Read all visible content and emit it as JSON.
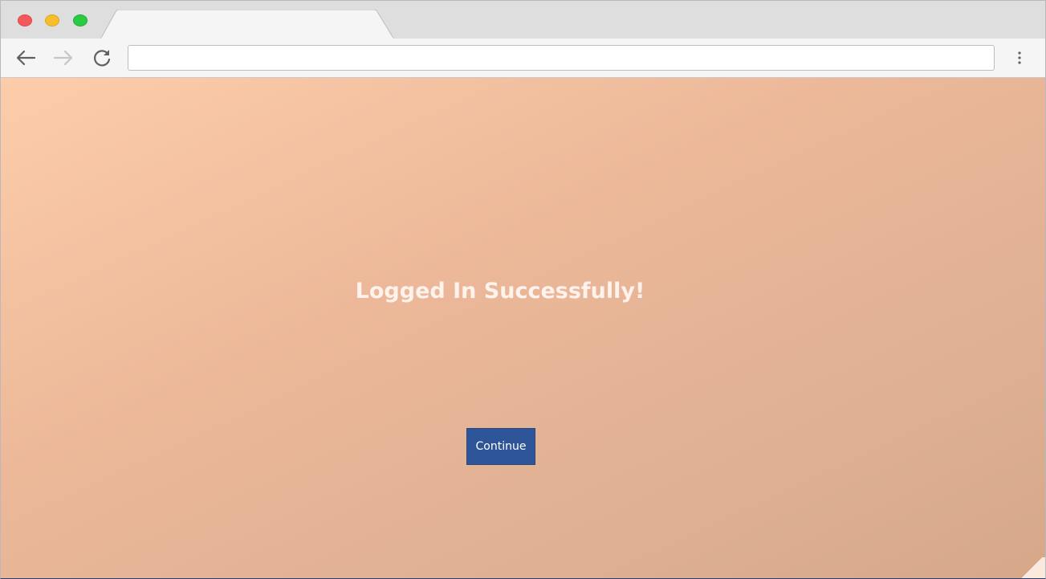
{
  "browser": {
    "tab": {
      "title": ""
    },
    "address_bar": {
      "value": "",
      "placeholder": ""
    },
    "icons": {
      "close": "red-close-dot-icon",
      "minimize": "yellow-minimize-dot-icon",
      "maximize": "green-maximize-dot-icon",
      "back": "back-arrow-icon",
      "forward": "forward-arrow-icon",
      "reload": "reload-icon",
      "menu": "kebab-menu-icon"
    },
    "colors": {
      "close": "#f4585a",
      "minimize": "#f8bd2d",
      "maximize": "#2acb43",
      "chrome_bg": "#dedede",
      "toolbar_bg": "#f5f5f5"
    }
  },
  "page": {
    "headline": "Logged In Successfully!",
    "continue_label": "Continue",
    "colors": {
      "gradient_start": "#fdcdab",
      "gradient_end": "#d6a889",
      "headline": "#fdf2ec",
      "button_bg": "#2d5597",
      "button_text": "#ffffff"
    }
  }
}
